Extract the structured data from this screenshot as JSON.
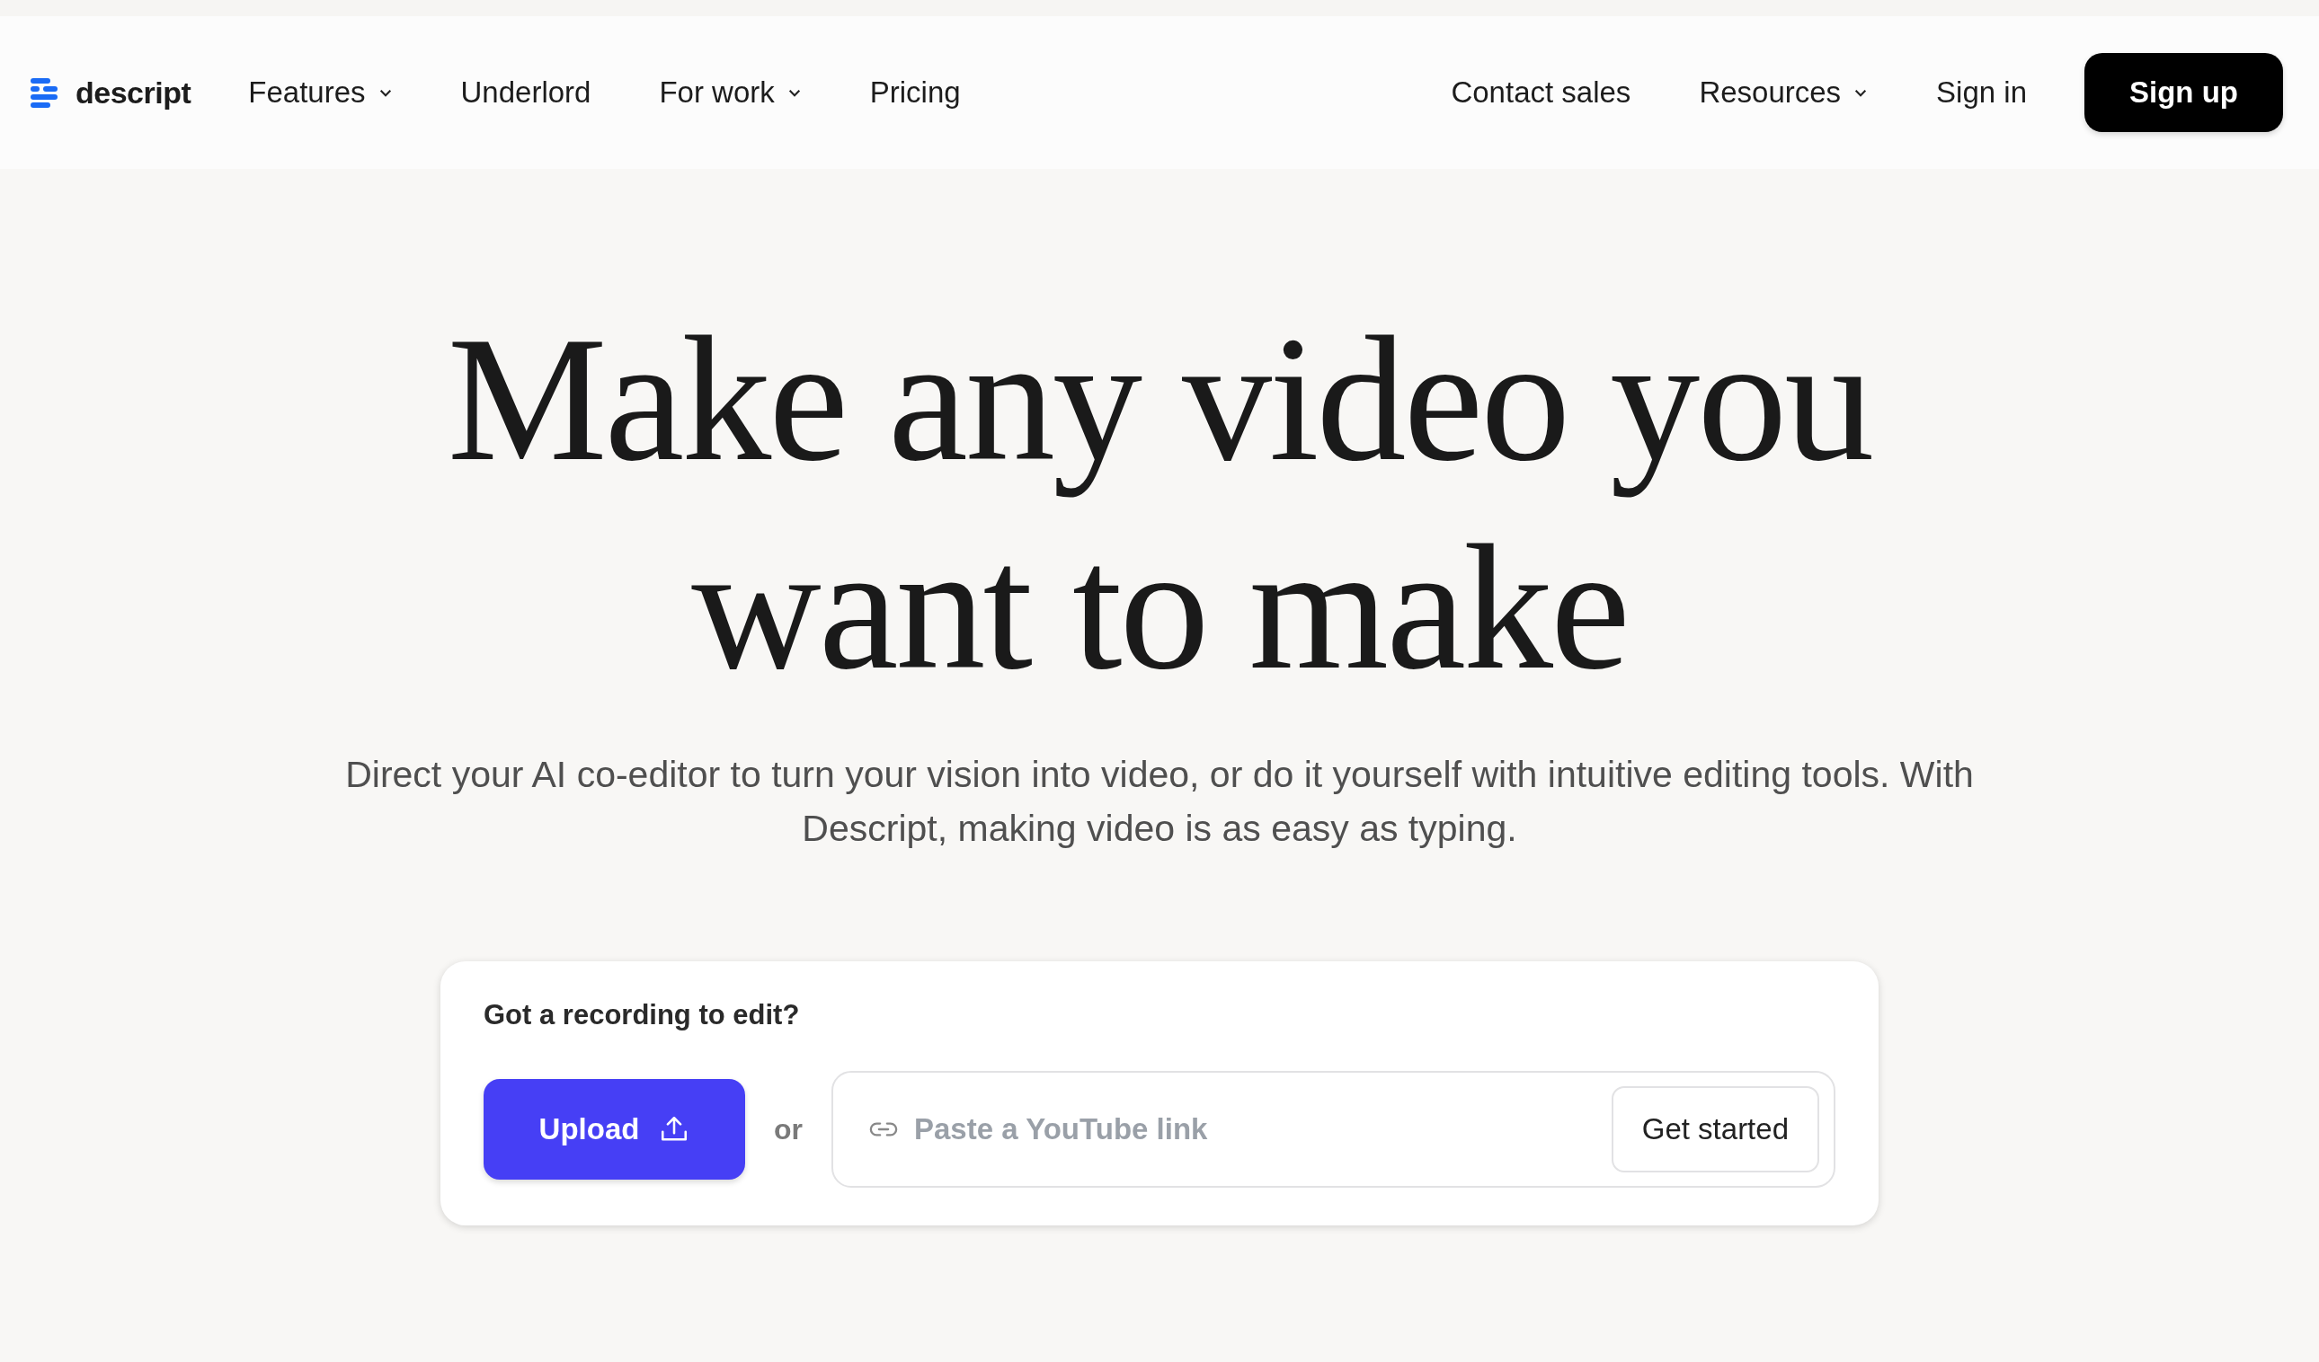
{
  "brand": {
    "name": "descript"
  },
  "nav": {
    "left": [
      {
        "label": "Features",
        "kind": "dropdown"
      },
      {
        "label": "Underlord",
        "kind": "link"
      },
      {
        "label": "For work",
        "kind": "dropdown"
      },
      {
        "label": "Pricing",
        "kind": "link"
      }
    ],
    "right": [
      {
        "label": "Contact sales",
        "kind": "link"
      },
      {
        "label": "Resources",
        "kind": "dropdown"
      },
      {
        "label": "Sign in",
        "kind": "link"
      },
      {
        "label": "Sign up",
        "kind": "primary"
      }
    ]
  },
  "hero": {
    "headline_lines": [
      "Make any video you",
      "want to make"
    ],
    "subtitle": "Direct your AI co-editor to turn your vision into video, or do it yourself with intuitive editing tools. With Descript, making video is as easy as typing."
  },
  "upload_card": {
    "title": "Got a recording to edit?",
    "upload_button": "Upload",
    "separator": "or",
    "link_field": {
      "placeholder": "Paste a YouTube link"
    },
    "submit_button": "Get started"
  }
}
